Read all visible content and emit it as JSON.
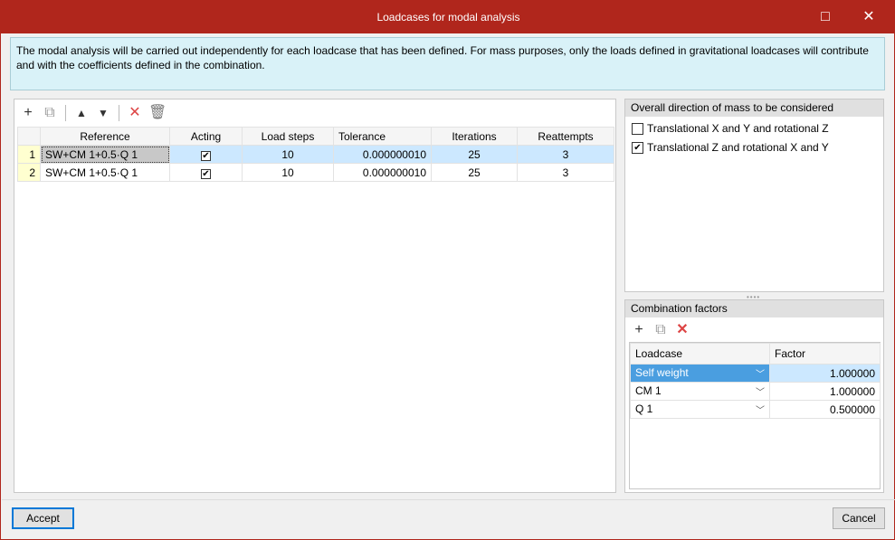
{
  "window": {
    "title": "Loadcases for modal analysis",
    "maximize_icon": "□",
    "close_icon": "✕"
  },
  "info": "The modal analysis will be carried out independently for each loadcase that has been defined. For mass purposes, only the loads defined in gravitational loadcases will contribute and with the coefficients defined in the combination.",
  "loadcases": {
    "columns": [
      "Reference",
      "Acting",
      "Load steps",
      "Tolerance",
      "Iterations",
      "Reattempts"
    ],
    "rows": [
      {
        "n": "1",
        "reference": "SW+CM 1+0.5·Q 1",
        "acting": true,
        "load_steps": "10",
        "tolerance": "0.000000010",
        "iterations": "25",
        "reattempts": "3"
      },
      {
        "n": "2",
        "reference": "SW+CM 1+0.5·Q 1",
        "acting": true,
        "load_steps": "10",
        "tolerance": "0.000000010",
        "iterations": "25",
        "reattempts": "3"
      }
    ]
  },
  "mass_direction": {
    "title": "Overall direction of mass to be considered",
    "options": [
      {
        "label": "Translational X and Y and rotational Z",
        "checked": false
      },
      {
        "label": "Translational Z and rotational X and Y",
        "checked": true
      }
    ]
  },
  "combination": {
    "title": "Combination factors",
    "columns": [
      "Loadcase",
      "Factor"
    ],
    "rows": [
      {
        "loadcase": "Self weight",
        "factor": "1.000000"
      },
      {
        "loadcase": "CM 1",
        "factor": "1.000000"
      },
      {
        "loadcase": "Q 1",
        "factor": "0.500000"
      }
    ]
  },
  "buttons": {
    "accept": "Accept",
    "cancel": "Cancel"
  },
  "check_mark": "✔"
}
